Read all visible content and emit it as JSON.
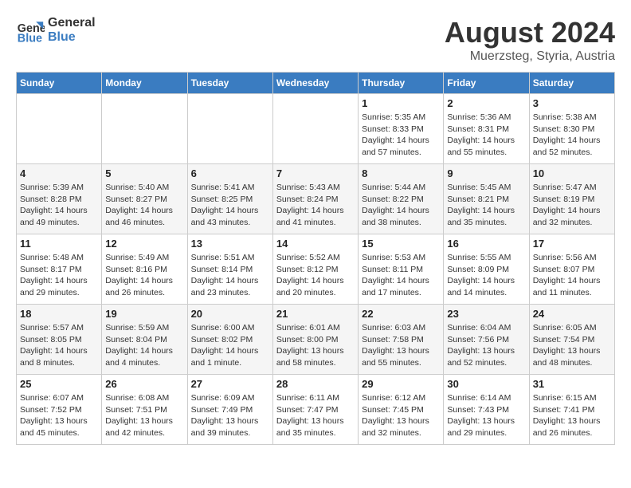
{
  "logo": {
    "line1": "General",
    "line2": "Blue"
  },
  "title": "August 2024",
  "location": "Muerzsteg, Styria, Austria",
  "weekdays": [
    "Sunday",
    "Monday",
    "Tuesday",
    "Wednesday",
    "Thursday",
    "Friday",
    "Saturday"
  ],
  "weeks": [
    [
      {
        "day": "",
        "info": ""
      },
      {
        "day": "",
        "info": ""
      },
      {
        "day": "",
        "info": ""
      },
      {
        "day": "",
        "info": ""
      },
      {
        "day": "1",
        "info": "Sunrise: 5:35 AM\nSunset: 8:33 PM\nDaylight: 14 hours\nand 57 minutes."
      },
      {
        "day": "2",
        "info": "Sunrise: 5:36 AM\nSunset: 8:31 PM\nDaylight: 14 hours\nand 55 minutes."
      },
      {
        "day": "3",
        "info": "Sunrise: 5:38 AM\nSunset: 8:30 PM\nDaylight: 14 hours\nand 52 minutes."
      }
    ],
    [
      {
        "day": "4",
        "info": "Sunrise: 5:39 AM\nSunset: 8:28 PM\nDaylight: 14 hours\nand 49 minutes."
      },
      {
        "day": "5",
        "info": "Sunrise: 5:40 AM\nSunset: 8:27 PM\nDaylight: 14 hours\nand 46 minutes."
      },
      {
        "day": "6",
        "info": "Sunrise: 5:41 AM\nSunset: 8:25 PM\nDaylight: 14 hours\nand 43 minutes."
      },
      {
        "day": "7",
        "info": "Sunrise: 5:43 AM\nSunset: 8:24 PM\nDaylight: 14 hours\nand 41 minutes."
      },
      {
        "day": "8",
        "info": "Sunrise: 5:44 AM\nSunset: 8:22 PM\nDaylight: 14 hours\nand 38 minutes."
      },
      {
        "day": "9",
        "info": "Sunrise: 5:45 AM\nSunset: 8:21 PM\nDaylight: 14 hours\nand 35 minutes."
      },
      {
        "day": "10",
        "info": "Sunrise: 5:47 AM\nSunset: 8:19 PM\nDaylight: 14 hours\nand 32 minutes."
      }
    ],
    [
      {
        "day": "11",
        "info": "Sunrise: 5:48 AM\nSunset: 8:17 PM\nDaylight: 14 hours\nand 29 minutes."
      },
      {
        "day": "12",
        "info": "Sunrise: 5:49 AM\nSunset: 8:16 PM\nDaylight: 14 hours\nand 26 minutes."
      },
      {
        "day": "13",
        "info": "Sunrise: 5:51 AM\nSunset: 8:14 PM\nDaylight: 14 hours\nand 23 minutes."
      },
      {
        "day": "14",
        "info": "Sunrise: 5:52 AM\nSunset: 8:12 PM\nDaylight: 14 hours\nand 20 minutes."
      },
      {
        "day": "15",
        "info": "Sunrise: 5:53 AM\nSunset: 8:11 PM\nDaylight: 14 hours\nand 17 minutes."
      },
      {
        "day": "16",
        "info": "Sunrise: 5:55 AM\nSunset: 8:09 PM\nDaylight: 14 hours\nand 14 minutes."
      },
      {
        "day": "17",
        "info": "Sunrise: 5:56 AM\nSunset: 8:07 PM\nDaylight: 14 hours\nand 11 minutes."
      }
    ],
    [
      {
        "day": "18",
        "info": "Sunrise: 5:57 AM\nSunset: 8:05 PM\nDaylight: 14 hours\nand 8 minutes."
      },
      {
        "day": "19",
        "info": "Sunrise: 5:59 AM\nSunset: 8:04 PM\nDaylight: 14 hours\nand 4 minutes."
      },
      {
        "day": "20",
        "info": "Sunrise: 6:00 AM\nSunset: 8:02 PM\nDaylight: 14 hours\nand 1 minute."
      },
      {
        "day": "21",
        "info": "Sunrise: 6:01 AM\nSunset: 8:00 PM\nDaylight: 13 hours\nand 58 minutes."
      },
      {
        "day": "22",
        "info": "Sunrise: 6:03 AM\nSunset: 7:58 PM\nDaylight: 13 hours\nand 55 minutes."
      },
      {
        "day": "23",
        "info": "Sunrise: 6:04 AM\nSunset: 7:56 PM\nDaylight: 13 hours\nand 52 minutes."
      },
      {
        "day": "24",
        "info": "Sunrise: 6:05 AM\nSunset: 7:54 PM\nDaylight: 13 hours\nand 48 minutes."
      }
    ],
    [
      {
        "day": "25",
        "info": "Sunrise: 6:07 AM\nSunset: 7:52 PM\nDaylight: 13 hours\nand 45 minutes."
      },
      {
        "day": "26",
        "info": "Sunrise: 6:08 AM\nSunset: 7:51 PM\nDaylight: 13 hours\nand 42 minutes."
      },
      {
        "day": "27",
        "info": "Sunrise: 6:09 AM\nSunset: 7:49 PM\nDaylight: 13 hours\nand 39 minutes."
      },
      {
        "day": "28",
        "info": "Sunrise: 6:11 AM\nSunset: 7:47 PM\nDaylight: 13 hours\nand 35 minutes."
      },
      {
        "day": "29",
        "info": "Sunrise: 6:12 AM\nSunset: 7:45 PM\nDaylight: 13 hours\nand 32 minutes."
      },
      {
        "day": "30",
        "info": "Sunrise: 6:14 AM\nSunset: 7:43 PM\nDaylight: 13 hours\nand 29 minutes."
      },
      {
        "day": "31",
        "info": "Sunrise: 6:15 AM\nSunset: 7:41 PM\nDaylight: 13 hours\nand 26 minutes."
      }
    ]
  ]
}
